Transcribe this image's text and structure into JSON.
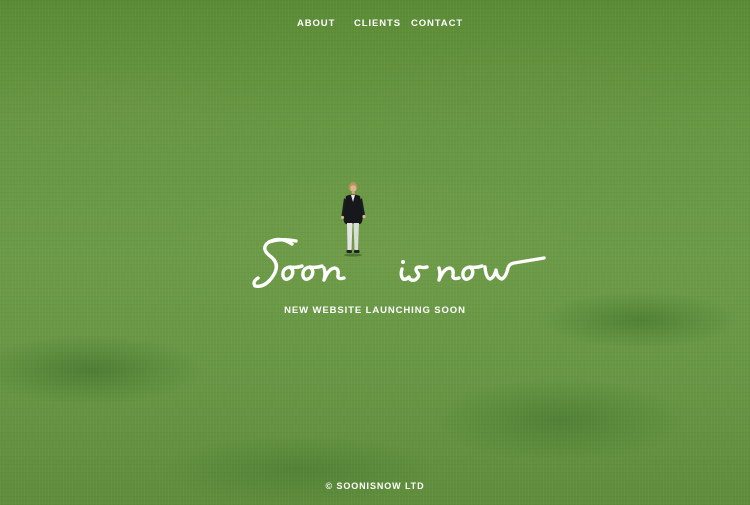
{
  "nav": {
    "items": [
      {
        "label": "ABOUT"
      },
      {
        "label": "CLIENTS"
      },
      {
        "label": "CONTACT"
      }
    ]
  },
  "hero": {
    "logo_text": "Soon is now",
    "tagline": "NEW WEBSITE LAUNCHING SOON",
    "background": "grass-field-photo",
    "figure": "child-walking-on-grass"
  },
  "footer": {
    "copyright": "© SOONISNOW LTD"
  },
  "colors": {
    "text": "#ffffff",
    "grass": "#6b9b47",
    "grass_dark": "#4f7a30"
  }
}
